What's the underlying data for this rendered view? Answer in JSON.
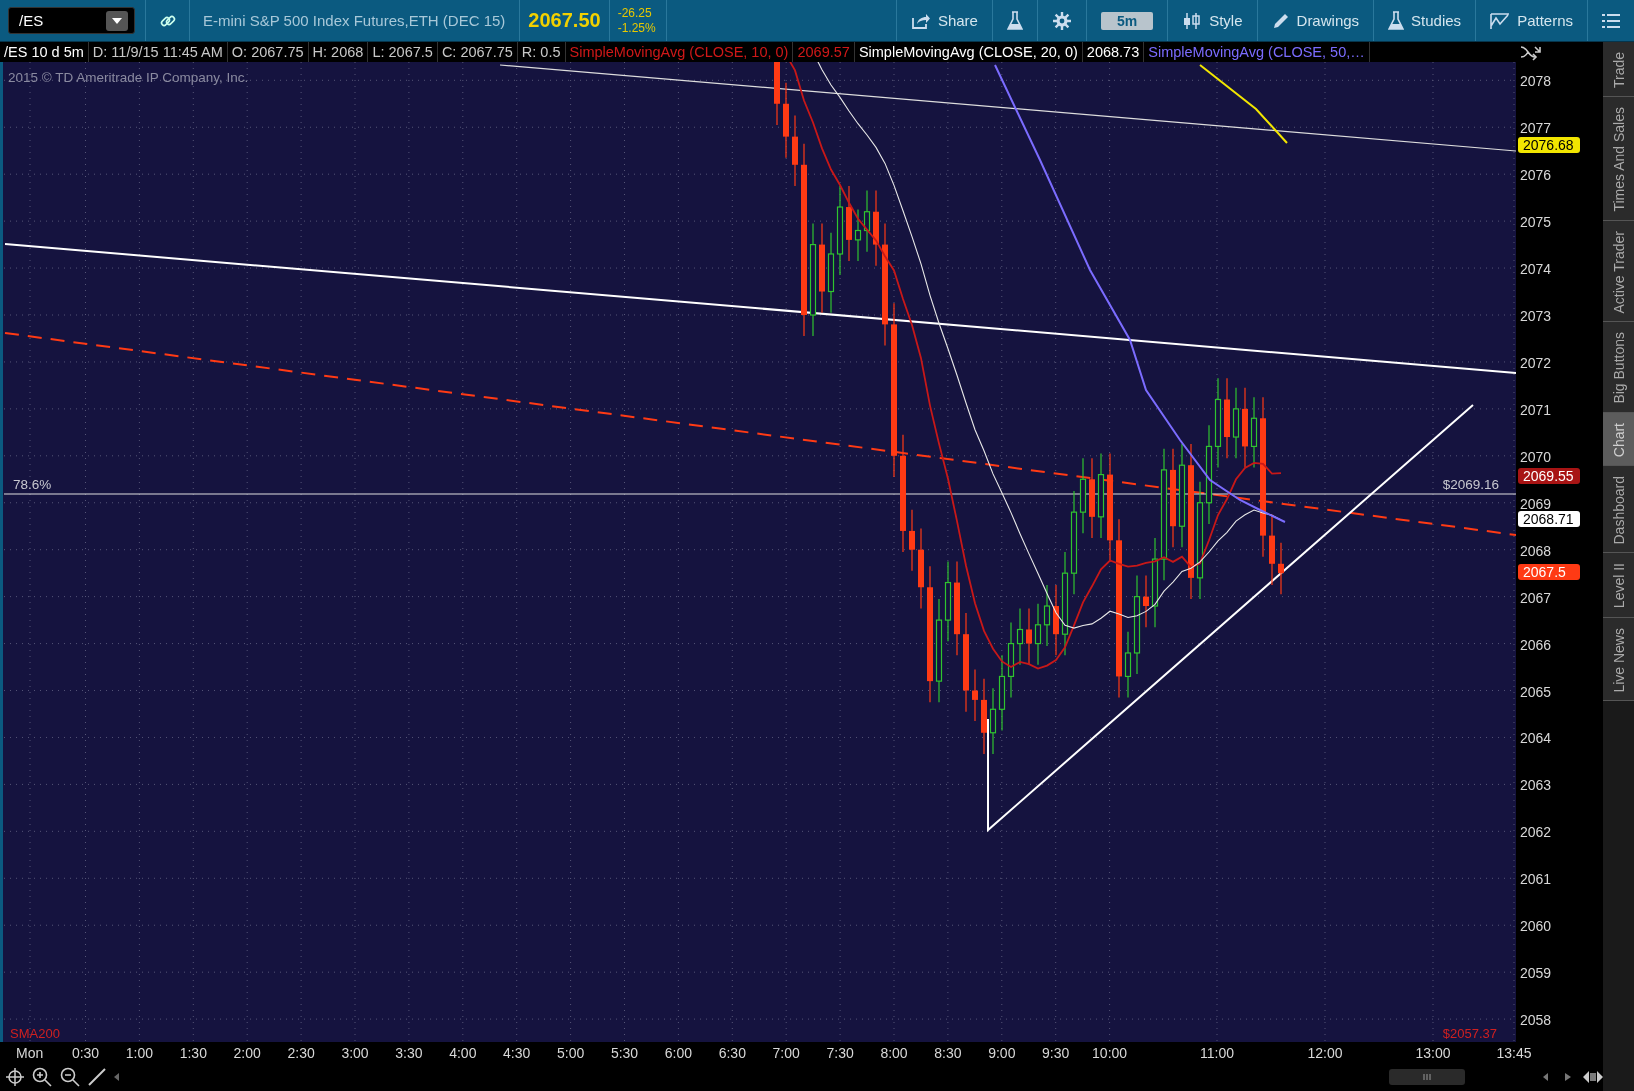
{
  "toolbar": {
    "symbol": "/ES",
    "instrument": "E-mini S&P 500 Index Futures,ETH (DEC 15)",
    "last_price": "2067.50",
    "change": "-26.25",
    "change_percent": "-1.25%",
    "buttons": [
      {
        "kind": "share",
        "label": "Share"
      },
      {
        "kind": "flask"
      },
      {
        "kind": "gear"
      },
      {
        "kind": "period",
        "label": "5m"
      },
      {
        "kind": "style",
        "label": "Style"
      },
      {
        "kind": "drawings",
        "label": "Drawings"
      },
      {
        "kind": "studies",
        "label": "Studies"
      },
      {
        "kind": "patterns",
        "label": "Patterns"
      },
      {
        "kind": "menu"
      }
    ]
  },
  "info_bar": [
    {
      "text": "/ES 10 d 5m",
      "kind": "symbol"
    },
    {
      "text": "D: 11/9/15 11:45 AM",
      "kind": "field"
    },
    {
      "text": "O: 2067.75",
      "kind": "field"
    },
    {
      "text": "H: 2068",
      "kind": "field"
    },
    {
      "text": "L: 2067.5",
      "kind": "field"
    },
    {
      "text": "C: 2067.75",
      "kind": "field"
    },
    {
      "text": "R: 0.5",
      "kind": "field"
    },
    {
      "text": "SimpleMovingAvg (CLOSE, 10, 0)",
      "kind": "study10"
    },
    {
      "text": "2069.57",
      "kind": "study10"
    },
    {
      "text": "SimpleMovingAvg (CLOSE, 20, 0)",
      "kind": "study20"
    },
    {
      "text": "2068.73",
      "kind": "study20"
    },
    {
      "text": "SimpleMovingAvg (CLOSE, 50,…",
      "kind": "study50"
    }
  ],
  "chart": {
    "copyright": "2015 © TD Ameritrade IP Company, Inc.",
    "fib_label": "78.6%",
    "fib_price": "$2069.16",
    "study_label": "SMA200",
    "study_price": "$2057.37",
    "price_ticks": [
      "2078",
      "2077",
      "2076",
      "2075",
      "2074",
      "2073",
      "2072",
      "2071",
      "2070",
      "2069",
      "2068",
      "2067",
      "2066",
      "2065",
      "2064",
      "2063",
      "2062",
      "2061",
      "2060",
      "2059",
      "2058"
    ],
    "time_ticks": [
      "Mon",
      "0:30",
      "1:00",
      "1:30",
      "2:00",
      "2:30",
      "3:00",
      "3:30",
      "4:00",
      "4:30",
      "5:00",
      "5:30",
      "6:00",
      "6:30",
      "7:00",
      "7:30",
      "8:00",
      "8:30",
      "9:00",
      "9:30",
      "10:00",
      "11:00",
      "12:00",
      "13:00",
      "13:45"
    ],
    "price_tags": [
      {
        "text": "2076.68",
        "color": "#f2e600"
      },
      {
        "text": "2069.55",
        "color": "#a81414"
      },
      {
        "text": "2068.71",
        "color": "#ffffff"
      },
      {
        "text": "2067.5",
        "color": "#ff3a14"
      }
    ]
  },
  "side_tabs": [
    {
      "label": "Trade",
      "selected": false
    },
    {
      "label": "Times And Sales",
      "selected": false
    },
    {
      "label": "Active Trader",
      "selected": false
    },
    {
      "label": "Big Buttons",
      "selected": false
    },
    {
      "label": "Chart",
      "selected": true
    },
    {
      "label": "Dashboard",
      "selected": false
    },
    {
      "label": "Level II",
      "selected": false
    },
    {
      "label": "Live News",
      "selected": false
    }
  ]
}
